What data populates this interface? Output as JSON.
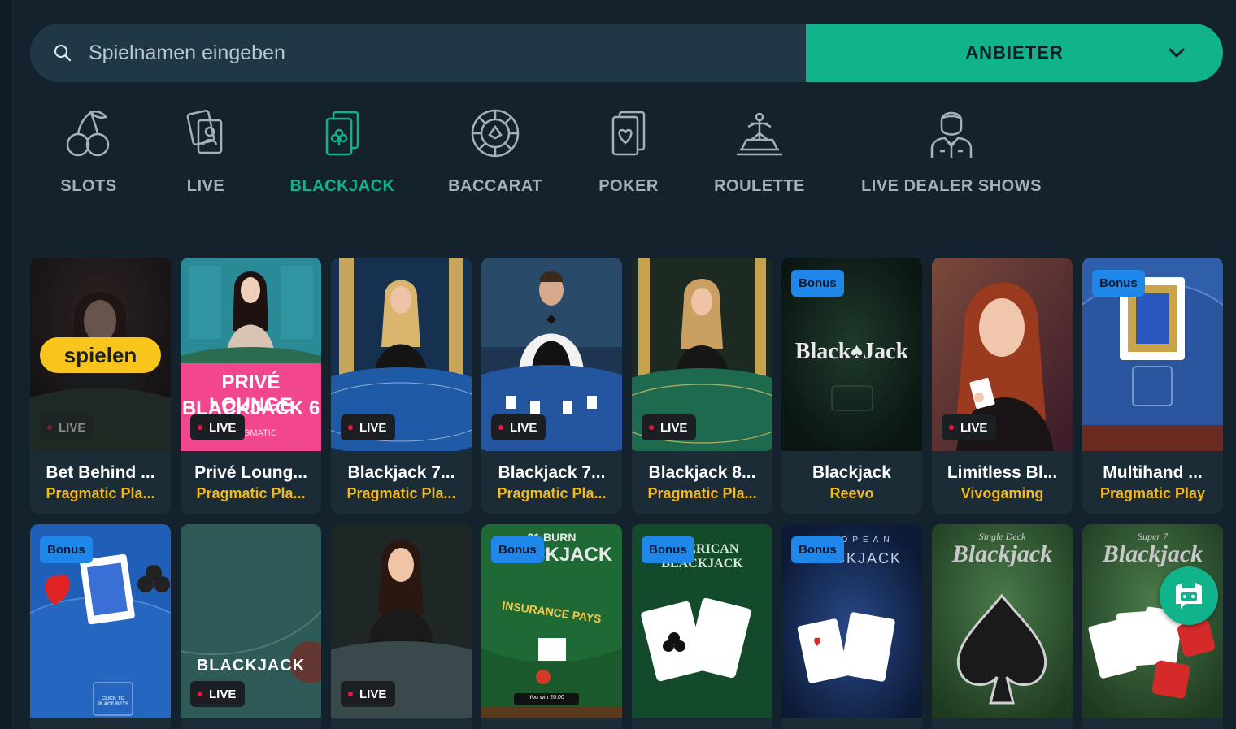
{
  "search": {
    "placeholder": "Spielnamen eingeben"
  },
  "provider_dropdown": {
    "label": "ANBIETER"
  },
  "categories": [
    {
      "label": "SLOTS",
      "icon": "cherries-icon"
    },
    {
      "label": "LIVE",
      "icon": "live-cards-icon"
    },
    {
      "label": "BLACKJACK",
      "icon": "blackjack-card-icon",
      "active": true
    },
    {
      "label": "BACCARAT",
      "icon": "chip-icon"
    },
    {
      "label": "POKER",
      "icon": "poker-cards-icon"
    },
    {
      "label": "ROULETTE",
      "icon": "roulette-wheel-icon"
    },
    {
      "label": "LIVE DEALER SHOWS",
      "icon": "dealer-icon"
    }
  ],
  "badges": {
    "live": "LIVE",
    "bonus": "Bonus",
    "play": "spielen"
  },
  "games_row1": [
    {
      "name": "Bet Behind ...",
      "provider": "Pragmatic Pla...",
      "live": true,
      "hover": true
    },
    {
      "name": "Privé Loung...",
      "provider": "Pragmatic Pla...",
      "live": true,
      "art_text": [
        "PRIVÉ LOUNGE",
        "BLACKJACK 6",
        "PRAGMATIC"
      ]
    },
    {
      "name": "Blackjack 7...",
      "provider": "Pragmatic Pla...",
      "live": true
    },
    {
      "name": "Blackjack 7...",
      "provider": "Pragmatic Pla...",
      "live": true
    },
    {
      "name": "Blackjack 8...",
      "provider": "Pragmatic Pla...",
      "live": true
    },
    {
      "name": "Blackjack",
      "provider": "Reevo",
      "bonus": true,
      "art_text": [
        "Black♠Jack"
      ]
    },
    {
      "name": "Limitless Bl...",
      "provider": "Vivogaming",
      "live": true
    },
    {
      "name": "Multihand ...",
      "provider": "Pragmatic Play",
      "bonus": true
    }
  ],
  "games_row2": [
    {
      "bonus": true,
      "art_text": [
        "CLICK TO PLACE BETS"
      ]
    },
    {
      "live": true,
      "art_text": [
        "BLACKJACK"
      ]
    },
    {
      "live": true
    },
    {
      "bonus": true,
      "art_text": [
        "21 BURN",
        "BLACKJACK",
        "INSURANCE PAYS",
        "You win 20.00"
      ]
    },
    {
      "bonus": true,
      "art_text": [
        "AMERICAN",
        "BLACKJACK"
      ]
    },
    {
      "bonus": true,
      "art_text": [
        "EUROPEAN",
        "BLACKJACK"
      ]
    },
    {
      "art_text": [
        "Single Deck",
        "Blackjack"
      ]
    },
    {
      "art_text": [
        "Super 7",
        "Blackjack"
      ]
    }
  ],
  "colors": {
    "accent": "#10b38b",
    "provider_text": "#f3b81a",
    "bonus": "#1f87ea",
    "play": "#f7c51c"
  }
}
